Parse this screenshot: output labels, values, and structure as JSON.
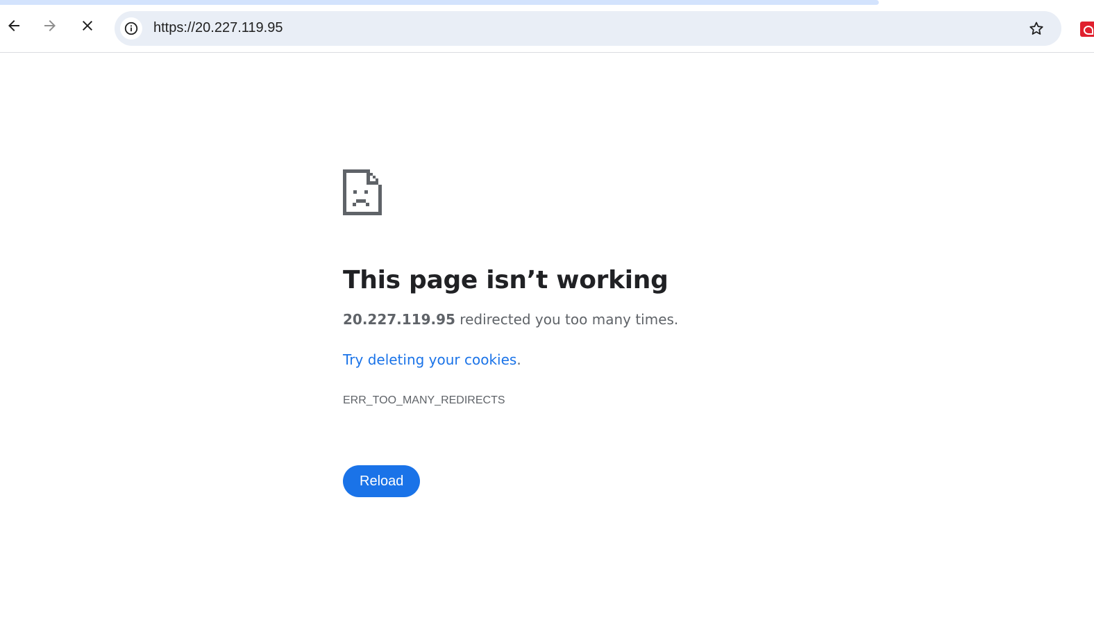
{
  "browser": {
    "url": "https://20.227.119.95",
    "accent_color": "#1a73e8",
    "icons": {
      "back": "arrow-left-icon",
      "forward": "arrow-right-icon",
      "stop": "close-icon",
      "site_info": "info-icon",
      "bookmark": "star-icon",
      "extension": "extension-icon"
    }
  },
  "error_page": {
    "icon": "sad-page-icon",
    "headline": "This page isn’t working",
    "summary_host": "20.227.119.95",
    "summary_rest": " redirected you too many times.",
    "suggestion_link": "Try deleting your cookies",
    "suggestion_tail": ".",
    "error_code": "ERR_TOO_MANY_REDIRECTS",
    "reload_label": "Reload"
  }
}
